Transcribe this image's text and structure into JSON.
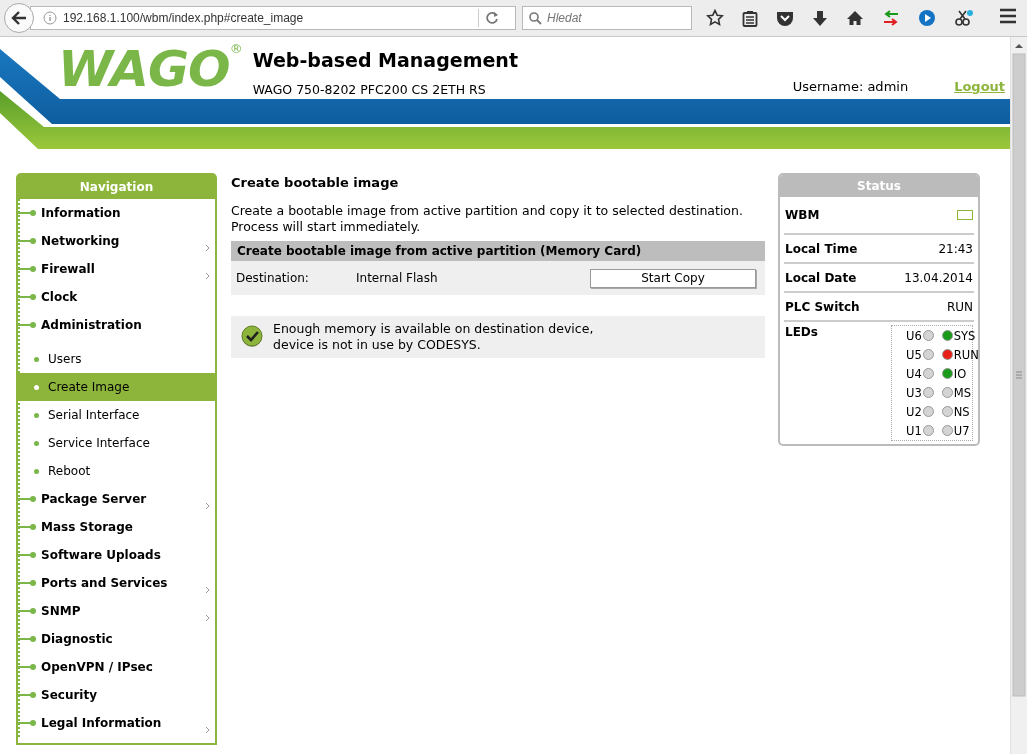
{
  "browser": {
    "url": "192.168.1.100/wbm/index.php#create_image",
    "search_placeholder": "Hledat"
  },
  "header": {
    "logo": "WAGO",
    "registered": "®",
    "title": "Web-based Management",
    "device": "WAGO 750-8202 PFC200 CS 2ETH RS",
    "user": "Username: admin",
    "logout": "Logout"
  },
  "navigation": {
    "title": "Navigation",
    "items": [
      {
        "label": "Information",
        "submenu": false,
        "selected": false
      },
      {
        "label": "Networking",
        "submenu": true,
        "selected": false
      },
      {
        "label": "Firewall",
        "submenu": true,
        "selected": false
      },
      {
        "label": "Clock",
        "submenu": false,
        "selected": false
      },
      {
        "label": "Administration",
        "submenu": false,
        "selected": false,
        "children": [
          {
            "label": "Users",
            "selected": false
          },
          {
            "label": "Create Image",
            "selected": true
          },
          {
            "label": "Serial Interface",
            "selected": false
          },
          {
            "label": "Service Interface",
            "selected": false
          },
          {
            "label": "Reboot",
            "selected": false
          }
        ]
      },
      {
        "label": "Package Server",
        "submenu": true,
        "selected": false
      },
      {
        "label": "Mass Storage",
        "submenu": false,
        "selected": false
      },
      {
        "label": "Software Uploads",
        "submenu": false,
        "selected": false
      },
      {
        "label": "Ports and Services",
        "submenu": true,
        "selected": false
      },
      {
        "label": "SNMP",
        "submenu": true,
        "selected": false
      },
      {
        "label": "Diagnostic",
        "submenu": false,
        "selected": false
      },
      {
        "label": "OpenVPN / IPsec",
        "submenu": false,
        "selected": false
      },
      {
        "label": "Security",
        "submenu": false,
        "selected": false
      },
      {
        "label": "Legal Information",
        "submenu": true,
        "selected": false
      }
    ]
  },
  "content": {
    "title": "Create bootable image",
    "description": [
      "Create a bootable image from active partition and copy it to selected destination.",
      "Process will start immediately."
    ],
    "section": {
      "title": "Create bootable image from active partition (Memory Card)",
      "label": "Destination:",
      "value": "Internal Flash",
      "button": "Start Copy"
    },
    "message": {
      "kind": "success",
      "lines": [
        "Enough memory is available on destination device,",
        "device is not in use by CODESYS."
      ]
    }
  },
  "status": {
    "title": "Status",
    "rows": [
      {
        "kind": "indicator",
        "label": "WBM"
      },
      {
        "kind": "text",
        "label": "Local Time",
        "value": "21:43"
      },
      {
        "kind": "text",
        "label": "Local Date",
        "value": "13.04.2014"
      },
      {
        "kind": "text",
        "label": "PLC Switch",
        "value": "RUN"
      },
      {
        "kind": "leds",
        "label": "LEDs",
        "leds": [
          {
            "left": {
              "label": "U6",
              "color": "#d4d4d4"
            },
            "right": {
              "label": "SYS",
              "color": "#1a9a1a"
            }
          },
          {
            "left": {
              "label": "U5",
              "color": "#d4d4d4"
            },
            "right": {
              "label": "RUN",
              "color": "#e8201a"
            }
          },
          {
            "left": {
              "label": "U4",
              "color": "#d4d4d4"
            },
            "right": {
              "label": "IO",
              "color": "#1a9a1a"
            }
          },
          {
            "left": {
              "label": "U3",
              "color": "#d4d4d4"
            },
            "right": {
              "label": "MS",
              "color": "#d4d4d4"
            }
          },
          {
            "left": {
              "label": "U2",
              "color": "#d4d4d4"
            },
            "right": {
              "label": "NS",
              "color": "#d4d4d4"
            }
          },
          {
            "left": {
              "label": "U1",
              "color": "#d4d4d4"
            },
            "right": {
              "label": "U7",
              "color": "#d4d4d4"
            }
          }
        ]
      }
    ]
  }
}
